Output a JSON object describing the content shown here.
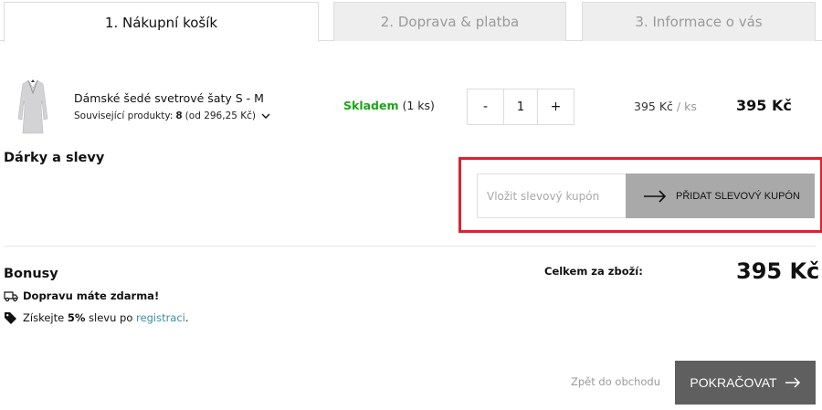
{
  "tabs": [
    {
      "label": "1. Nákupní košík",
      "active": true
    },
    {
      "label": "2. Doprava & platba",
      "active": false
    },
    {
      "label": "3. Informace o vás",
      "active": false
    }
  ],
  "cart_item": {
    "name": "Dámské šedé svetrové šaty S - M",
    "related_prefix": "Související produkty:",
    "related_count": "8",
    "related_from": "(od 296,25 Kč)",
    "stock_status": "Skladem",
    "stock_qty": "(1 ks)",
    "qty_minus": "-",
    "quantity": "1",
    "qty_plus": "+",
    "unit_price": "395 Kč",
    "unit_suffix": "/ ks",
    "row_total": "395 Kč"
  },
  "gifts": {
    "title": "Dárky a slevy",
    "coupon_placeholder": "Vložit slevový kupón",
    "coupon_button": "PŘIDAT SLEVOVÝ KUPÓN"
  },
  "bonuses": {
    "title": "Bonusy",
    "free_shipping": "Dopravu máte zdarma!",
    "discount_prefix": "Získejte",
    "discount_value": "5%",
    "discount_middle": "slevu po",
    "discount_link": "registraci",
    "discount_suffix": "."
  },
  "summary": {
    "total_label": "Celkem za zboží:",
    "total_value": "395 Kč"
  },
  "actions": {
    "back_label": "Zpět do obchodu",
    "continue_label": "POKRAČOVAT"
  },
  "colors": {
    "stock_green": "#1aa516",
    "highlight_red": "#e0202a",
    "link_teal": "#3a8fa0",
    "continue_bg": "#5f5f5f",
    "coupon_bg": "#a9a9a9"
  },
  "icons": [
    "chevron-down-icon",
    "arrow-right-icon",
    "truck-icon",
    "tag-icon"
  ]
}
